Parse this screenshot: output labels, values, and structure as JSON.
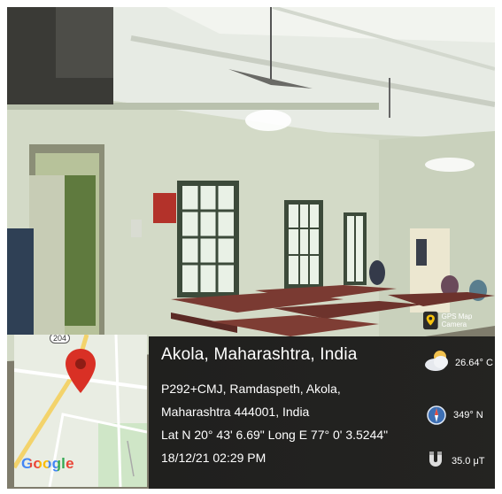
{
  "location": {
    "title": "Akola, Maharashtra, India",
    "address_line1": "P292+CMJ, Ramdaspeth, Akola,",
    "address_line2": "Maharashtra 444001, India",
    "coordinates": "Lat N 20° 43' 6.69\" Long E 77° 0' 3.5244\"",
    "datetime": "18/12/21 02:29 PM"
  },
  "app_badge": {
    "label": "GPS Map Camera",
    "icon": "camera-pin-icon"
  },
  "weather": {
    "temperature": "26.64° C",
    "icon": "cloud-sun-icon"
  },
  "compass": {
    "heading": "349° N",
    "icon": "compass-icon"
  },
  "magnetic": {
    "field": "35.0 μT",
    "icon": "magnet-icon"
  },
  "map": {
    "road_number": "204",
    "logo_text": "Google",
    "pin_icon": "map-pin-icon"
  },
  "colors": {
    "overlay": "#191919",
    "wall": "#d6dcc9",
    "pin": "#d93025"
  }
}
